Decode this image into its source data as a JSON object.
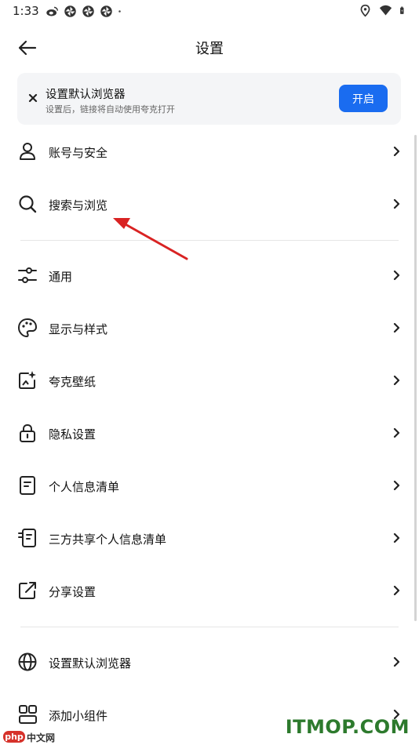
{
  "status_bar": {
    "time": "1:33",
    "left_icons": [
      "weibo-icon",
      "pinwheel-icon",
      "pinwheel-icon",
      "pinwheel-icon",
      "dot-icon"
    ],
    "right_icons": [
      "location-icon",
      "wifi-icon",
      "battery-icon"
    ]
  },
  "header": {
    "title": "设置",
    "back_icon": "arrow-left-icon"
  },
  "banner": {
    "title": "设置默认浏览器",
    "subtitle": "设置后，链接将自动使用夸克打开",
    "button_label": "开启",
    "accent_color": "#1a6cf0"
  },
  "settings": {
    "group1": [
      {
        "label": "账号与安全",
        "icon": "person-icon"
      },
      {
        "label": "搜索与浏览",
        "icon": "search-icon"
      }
    ],
    "group2": [
      {
        "label": "通用",
        "icon": "sliders-icon"
      },
      {
        "label": "显示与样式",
        "icon": "palette-icon"
      },
      {
        "label": "夸克壁纸",
        "icon": "wallpaper-icon"
      },
      {
        "label": "隐私设置",
        "icon": "lock-icon"
      },
      {
        "label": "个人信息清单",
        "icon": "document-icon"
      },
      {
        "label": "三方共享个人信息清单",
        "icon": "shared-document-icon"
      },
      {
        "label": "分享设置",
        "icon": "share-icon"
      }
    ],
    "group3": [
      {
        "label": "设置默认浏览器",
        "icon": "globe-icon"
      },
      {
        "label": "添加小组件",
        "icon": "widgets-icon"
      }
    ]
  },
  "watermarks": {
    "left_badge": "php",
    "left_text": "中文网",
    "right_text": "ITMOP.COM"
  },
  "annotation_color": "#d92323"
}
